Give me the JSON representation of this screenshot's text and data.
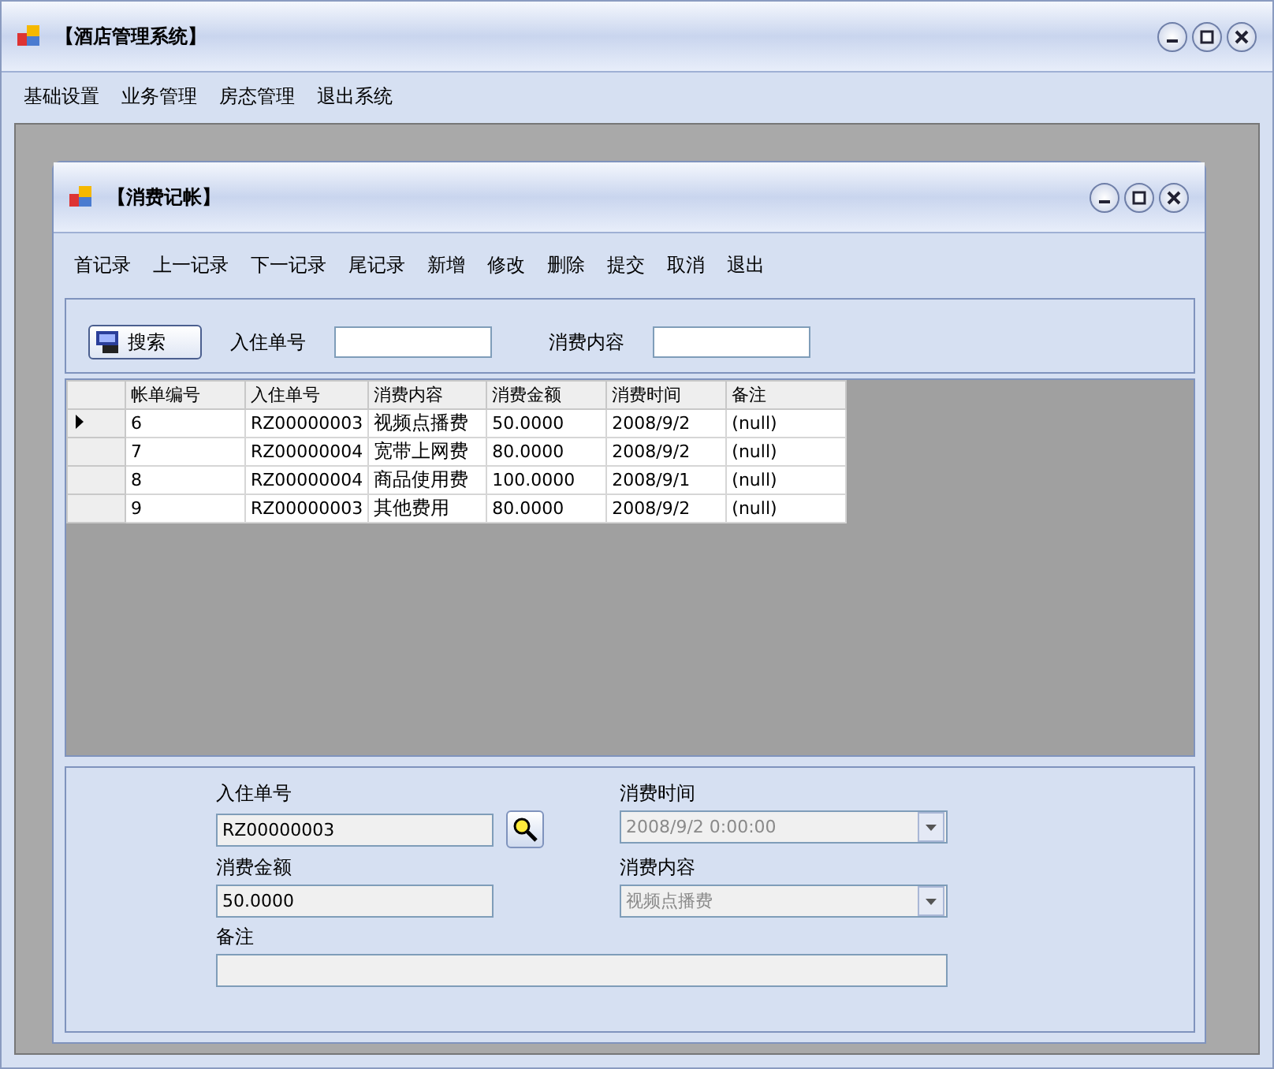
{
  "window": {
    "title": "【酒店管理系统】"
  },
  "menu": [
    "基础设置",
    "业务管理",
    "房态管理",
    "退出系统"
  ],
  "child_window": {
    "title": "【消费记帐】"
  },
  "toolbar": [
    "首记录",
    "上一记录",
    "下一记录",
    "尾记录",
    "新增",
    "修改",
    "删除",
    "提交",
    "取消",
    "退出"
  ],
  "search": {
    "button": "搜索",
    "fields": [
      {
        "label": "入住单号"
      },
      {
        "label": "消费内容"
      }
    ]
  },
  "table": {
    "columns": [
      "帐单编号",
      "入住单号",
      "消费内容",
      "消费金额",
      "消费时间",
      "备注"
    ],
    "rows": [
      {
        "selected": true,
        "cells": [
          "6",
          "RZ00000003",
          "视频点播费",
          "50.0000",
          "2008/9/2",
          "(null)"
        ]
      },
      {
        "selected": false,
        "cells": [
          "7",
          "RZ00000004",
          "宽带上网费",
          "80.0000",
          "2008/9/2",
          "(null)"
        ]
      },
      {
        "selected": false,
        "cells": [
          "8",
          "RZ00000004",
          "商品使用费",
          "100.0000",
          "2008/9/1",
          "(null)"
        ]
      },
      {
        "selected": false,
        "cells": [
          "9",
          "RZ00000003",
          "其他费用",
          "80.0000",
          "2008/9/2",
          "(null)"
        ]
      }
    ]
  },
  "form": {
    "fields": [
      {
        "kind": "text",
        "label": "入住单号",
        "value": "RZ00000003",
        "lookup": true
      },
      {
        "kind": "combo",
        "label": "消费时间",
        "value": "2008/9/2 0:00:00",
        "disabled": true
      },
      {
        "kind": "text",
        "label": "消费金额",
        "value": "50.0000"
      },
      {
        "kind": "combo",
        "label": "消费内容",
        "value": "视频点播费",
        "disabled": true
      },
      {
        "kind": "wide",
        "label": "备注"
      }
    ]
  }
}
